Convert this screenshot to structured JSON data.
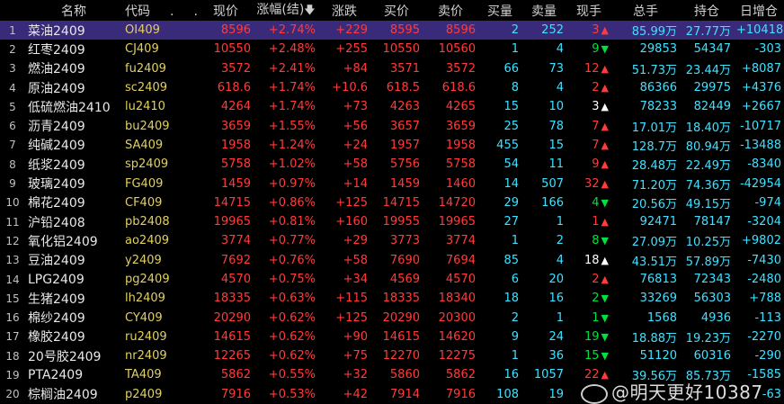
{
  "header": {
    "cols": [
      "",
      "名称",
      "代码",
      "现价",
      "涨幅(结)",
      "涨跌",
      "买价",
      "卖价",
      "买量",
      "卖量",
      "现手",
      "总手",
      "持仓",
      "日增仓"
    ],
    "sort_icon": "arrow-down-icon",
    "dots": [
      ".",
      "."
    ]
  },
  "rows": [
    {
      "idx": "1",
      "name": "菜油2409",
      "code": "OI409",
      "price": "8596",
      "pct": "+2.74%",
      "chg": "+229",
      "bid": "8595",
      "ask": "8596",
      "bidvol": "2",
      "askvol": "252",
      "hand": "3",
      "dir": "up",
      "vol": "85.99万",
      "oi": "27.77万",
      "dayoi": "+10418"
    },
    {
      "idx": "2",
      "name": "红枣2409",
      "code": "CJ409",
      "price": "10550",
      "pct": "+2.48%",
      "chg": "+255",
      "bid": "10550",
      "ask": "10560",
      "bidvol": "1",
      "askvol": "4",
      "hand": "9",
      "dir": "down",
      "vol": "29853",
      "oi": "54347",
      "dayoi": "-303"
    },
    {
      "idx": "3",
      "name": "燃油2409",
      "code": "fu2409",
      "price": "3572",
      "pct": "+2.41%",
      "chg": "+84",
      "bid": "3571",
      "ask": "3572",
      "bidvol": "66",
      "askvol": "73",
      "hand": "12",
      "dir": "up",
      "vol": "51.73万",
      "oi": "23.44万",
      "dayoi": "+8087"
    },
    {
      "idx": "4",
      "name": "原油2409",
      "code": "sc2409",
      "price": "618.6",
      "pct": "+1.74%",
      "chg": "+10.6",
      "bid": "618.5",
      "ask": "618.6",
      "bidvol": "8",
      "askvol": "4",
      "hand": "2",
      "dir": "up",
      "vol": "86366",
      "oi": "29975",
      "dayoi": "+4376"
    },
    {
      "idx": "5",
      "name": "低硫燃油2410",
      "code": "lu2410",
      "price": "4264",
      "pct": "+1.74%",
      "chg": "+73",
      "bid": "4263",
      "ask": "4265",
      "bidvol": "15",
      "askvol": "10",
      "hand": "3",
      "dir": "white",
      "vol": "78233",
      "oi": "82449",
      "dayoi": "+2667"
    },
    {
      "idx": "6",
      "name": "沥青2409",
      "code": "bu2409",
      "price": "3659",
      "pct": "+1.55%",
      "chg": "+56",
      "bid": "3657",
      "ask": "3659",
      "bidvol": "25",
      "askvol": "78",
      "hand": "7",
      "dir": "up",
      "vol": "17.01万",
      "oi": "18.40万",
      "dayoi": "-10717"
    },
    {
      "idx": "7",
      "name": "纯碱2409",
      "code": "SA409",
      "price": "1958",
      "pct": "+1.24%",
      "chg": "+24",
      "bid": "1957",
      "ask": "1958",
      "bidvol": "455",
      "askvol": "15",
      "hand": "7",
      "dir": "up",
      "vol": "128.7万",
      "oi": "80.94万",
      "dayoi": "-13488"
    },
    {
      "idx": "8",
      "name": "纸浆2409",
      "code": "sp2409",
      "price": "5758",
      "pct": "+1.02%",
      "chg": "+58",
      "bid": "5756",
      "ask": "5758",
      "bidvol": "54",
      "askvol": "11",
      "hand": "9",
      "dir": "up",
      "vol": "28.48万",
      "oi": "22.49万",
      "dayoi": "-8340"
    },
    {
      "idx": "9",
      "name": "玻璃2409",
      "code": "FG409",
      "price": "1459",
      "pct": "+0.97%",
      "chg": "+14",
      "bid": "1459",
      "ask": "1460",
      "bidvol": "14",
      "askvol": "507",
      "hand": "32",
      "dir": "up",
      "vol": "71.20万",
      "oi": "74.36万",
      "dayoi": "-42954"
    },
    {
      "idx": "10",
      "name": "棉花2409",
      "code": "CF409",
      "price": "14715",
      "pct": "+0.86%",
      "chg": "+125",
      "bid": "14715",
      "ask": "14720",
      "bidvol": "29",
      "askvol": "166",
      "hand": "4",
      "dir": "down",
      "vol": "20.56万",
      "oi": "49.15万",
      "dayoi": "-974"
    },
    {
      "idx": "11",
      "name": "沪铅2408",
      "code": "pb2408",
      "price": "19965",
      "pct": "+0.81%",
      "chg": "+160",
      "bid": "19955",
      "ask": "19965",
      "bidvol": "27",
      "askvol": "1",
      "hand": "1",
      "dir": "up",
      "vol": "92471",
      "oi": "78147",
      "dayoi": "-3204"
    },
    {
      "idx": "12",
      "name": "氧化铝2409",
      "code": "ao2409",
      "price": "3774",
      "pct": "+0.77%",
      "chg": "+29",
      "bid": "3773",
      "ask": "3774",
      "bidvol": "1",
      "askvol": "2",
      "hand": "8",
      "dir": "down",
      "vol": "27.09万",
      "oi": "10.25万",
      "dayoi": "+9802"
    },
    {
      "idx": "13",
      "name": "豆油2409",
      "code": "y2409",
      "price": "7692",
      "pct": "+0.76%",
      "chg": "+58",
      "bid": "7690",
      "ask": "7694",
      "bidvol": "85",
      "askvol": "4",
      "hand": "18",
      "dir": "white",
      "vol": "43.51万",
      "oi": "57.89万",
      "dayoi": "-7430"
    },
    {
      "idx": "14",
      "name": "LPG2409",
      "code": "pg2409",
      "price": "4570",
      "pct": "+0.75%",
      "chg": "+34",
      "bid": "4569",
      "ask": "4570",
      "bidvol": "6",
      "askvol": "20",
      "hand": "2",
      "dir": "up",
      "vol": "76813",
      "oi": "72343",
      "dayoi": "-2480"
    },
    {
      "idx": "15",
      "name": "生猪2409",
      "code": "lh2409",
      "price": "18335",
      "pct": "+0.63%",
      "chg": "+115",
      "bid": "18335",
      "ask": "18340",
      "bidvol": "18",
      "askvol": "16",
      "hand": "2",
      "dir": "down",
      "vol": "33269",
      "oi": "56303",
      "dayoi": "+788"
    },
    {
      "idx": "16",
      "name": "棉纱2409",
      "code": "CY409",
      "price": "20290",
      "pct": "+0.62%",
      "chg": "+125",
      "bid": "20290",
      "ask": "20300",
      "bidvol": "2",
      "askvol": "1",
      "hand": "1",
      "dir": "down",
      "vol": "1568",
      "oi": "4936",
      "dayoi": "-113"
    },
    {
      "idx": "17",
      "name": "橡胶2409",
      "code": "ru2409",
      "price": "14615",
      "pct": "+0.62%",
      "chg": "+90",
      "bid": "14615",
      "ask": "14620",
      "bidvol": "9",
      "askvol": "24",
      "hand": "19",
      "dir": "down",
      "vol": "18.88万",
      "oi": "19.23万",
      "dayoi": "-2270"
    },
    {
      "idx": "18",
      "name": "20号胶2409",
      "code": "nr2409",
      "price": "12265",
      "pct": "+0.62%",
      "chg": "+75",
      "bid": "12270",
      "ask": "12275",
      "bidvol": "1",
      "askvol": "36",
      "hand": "15",
      "dir": "down",
      "vol": "51120",
      "oi": "60316",
      "dayoi": "-290"
    },
    {
      "idx": "19",
      "name": "PTA2409",
      "code": "TA409",
      "price": "5862",
      "pct": "+0.55%",
      "chg": "+32",
      "bid": "5860",
      "ask": "5862",
      "bidvol": "16",
      "askvol": "1057",
      "hand": "22",
      "dir": "up",
      "vol": "39.56万",
      "oi": "85.73万",
      "dayoi": "-1585"
    },
    {
      "idx": "20",
      "name": "棕榈油2409",
      "code": "p2409",
      "price": "7916",
      "pct": "+0.53%",
      "chg": "+42",
      "bid": "7914",
      "ask": "7916",
      "bidvol": "108",
      "askvol": "19",
      "hand": "",
      "dir": "none",
      "vol": "",
      "oi": "",
      "dayoi": "-63"
    }
  ],
  "watermark": "@明天更好10387",
  "colors": {
    "up": "#ff3b3b",
    "down": "#00e040",
    "cyan": "#40e0ff",
    "code": "#e0d060",
    "selected_bg": "#3a2a7a"
  }
}
